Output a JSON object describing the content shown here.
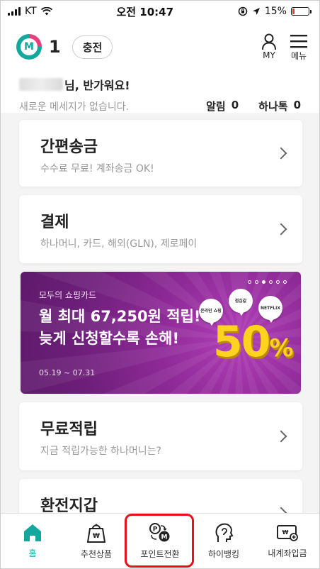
{
  "status_bar": {
    "carrier": "KT",
    "time": "오전 10:47",
    "battery_percent": "15%",
    "battery_level": 0.15
  },
  "header": {
    "points": "1",
    "charge_label": "충전",
    "my_label": "MY",
    "menu_label": "메뉴"
  },
  "greeting": {
    "name_suffix": "님, 반가워요!",
    "no_message": "새로운 메세지가 없습니다.",
    "alert_label": "알림",
    "alert_count": "0",
    "hanatalk_label": "하나톡",
    "hanatalk_count": "0"
  },
  "cards": [
    {
      "title": "간편송금",
      "subtitle": "수수료 무료! 계좌송금 OK!"
    },
    {
      "title": "결제",
      "subtitle": "하나머니, 카드, 해외(GLN), 제로페이"
    },
    {
      "title": "무료적립",
      "subtitle": "지금 적립가능한 하나머니는?"
    },
    {
      "title": "환전지갑",
      "subtitle": ""
    }
  ],
  "banner": {
    "subtitle": "모두의 쇼핑카드",
    "title_line1": "월 최대 67,250원 적립!",
    "title_line2": "늦게 신청할수록 손해!",
    "date_range": "05.19 ~ 07.31",
    "percent": "50",
    "percent_sign": "%",
    "bubble_online": "온라인 쇼핑",
    "bubble_lunch": "점심값",
    "bubble_netflix": "NETFLIX",
    "page_count": 6,
    "active_page": 3
  },
  "bottom_nav": [
    {
      "label": "홈",
      "icon": "home-icon"
    },
    {
      "label": "추천상품",
      "icon": "gift-bag-icon"
    },
    {
      "label": "포인트전환",
      "icon": "point-convert-icon"
    },
    {
      "label": "하이뱅킹",
      "icon": "hibanking-icon"
    },
    {
      "label": "내계좌입금",
      "icon": "account-deposit-icon"
    }
  ],
  "colors": {
    "brand_teal": "#13a89e",
    "brand_pink": "#e8407a",
    "banner_purple": "#8e2a97",
    "highlight_red": "#e5121b"
  }
}
